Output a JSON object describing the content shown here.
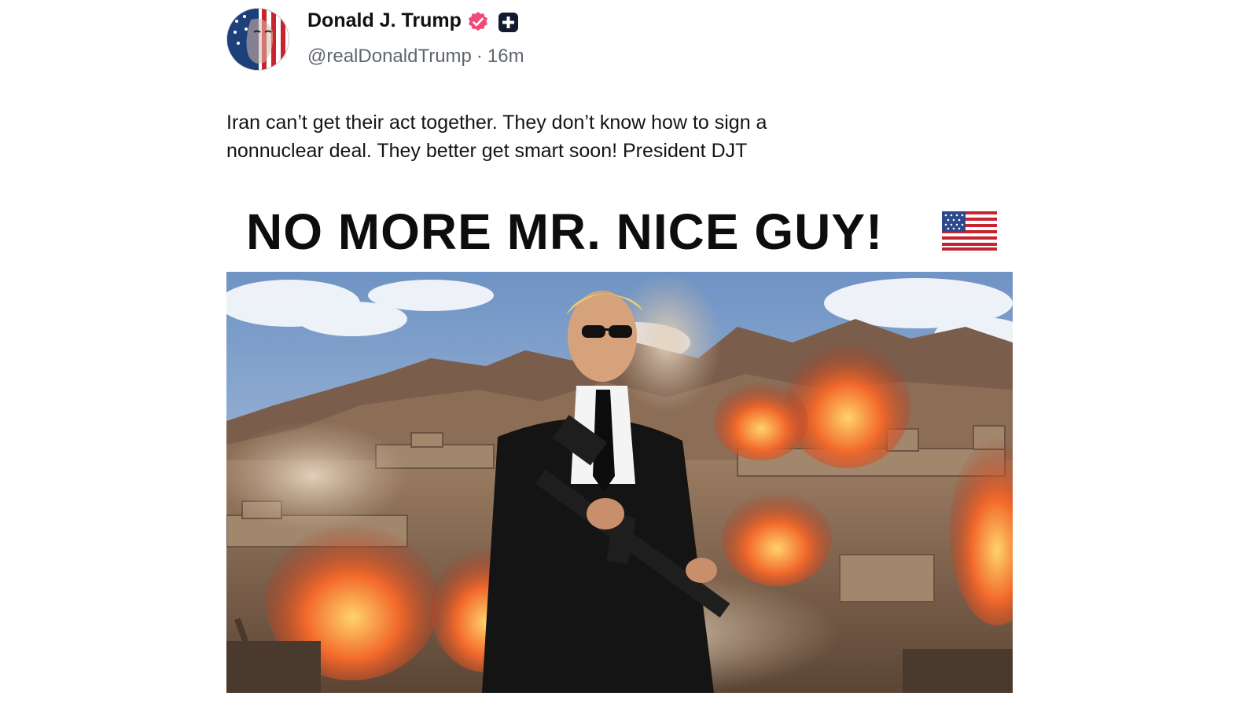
{
  "post": {
    "display_name": "Donald J. Trump",
    "handle": "@realDonaldTrump",
    "separator": "·",
    "time": "16m",
    "text_line1": "Iran can’t get their act together. They don’t know how to sign a",
    "text_line2": "nonnuclear deal. They better get smart soon! President DJT"
  },
  "media": {
    "headline": "NO MORE MR. NICE GUY!",
    "flag_icon": "us-flag-icon"
  },
  "icons": {
    "verified": "verified-badge-icon",
    "app_badge": "plus-badge-icon"
  },
  "colors": {
    "verified_pink": "#ef4b7a",
    "name_text": "#111111",
    "handle_text": "#5f6670",
    "fire_orange": "#f2692b"
  }
}
